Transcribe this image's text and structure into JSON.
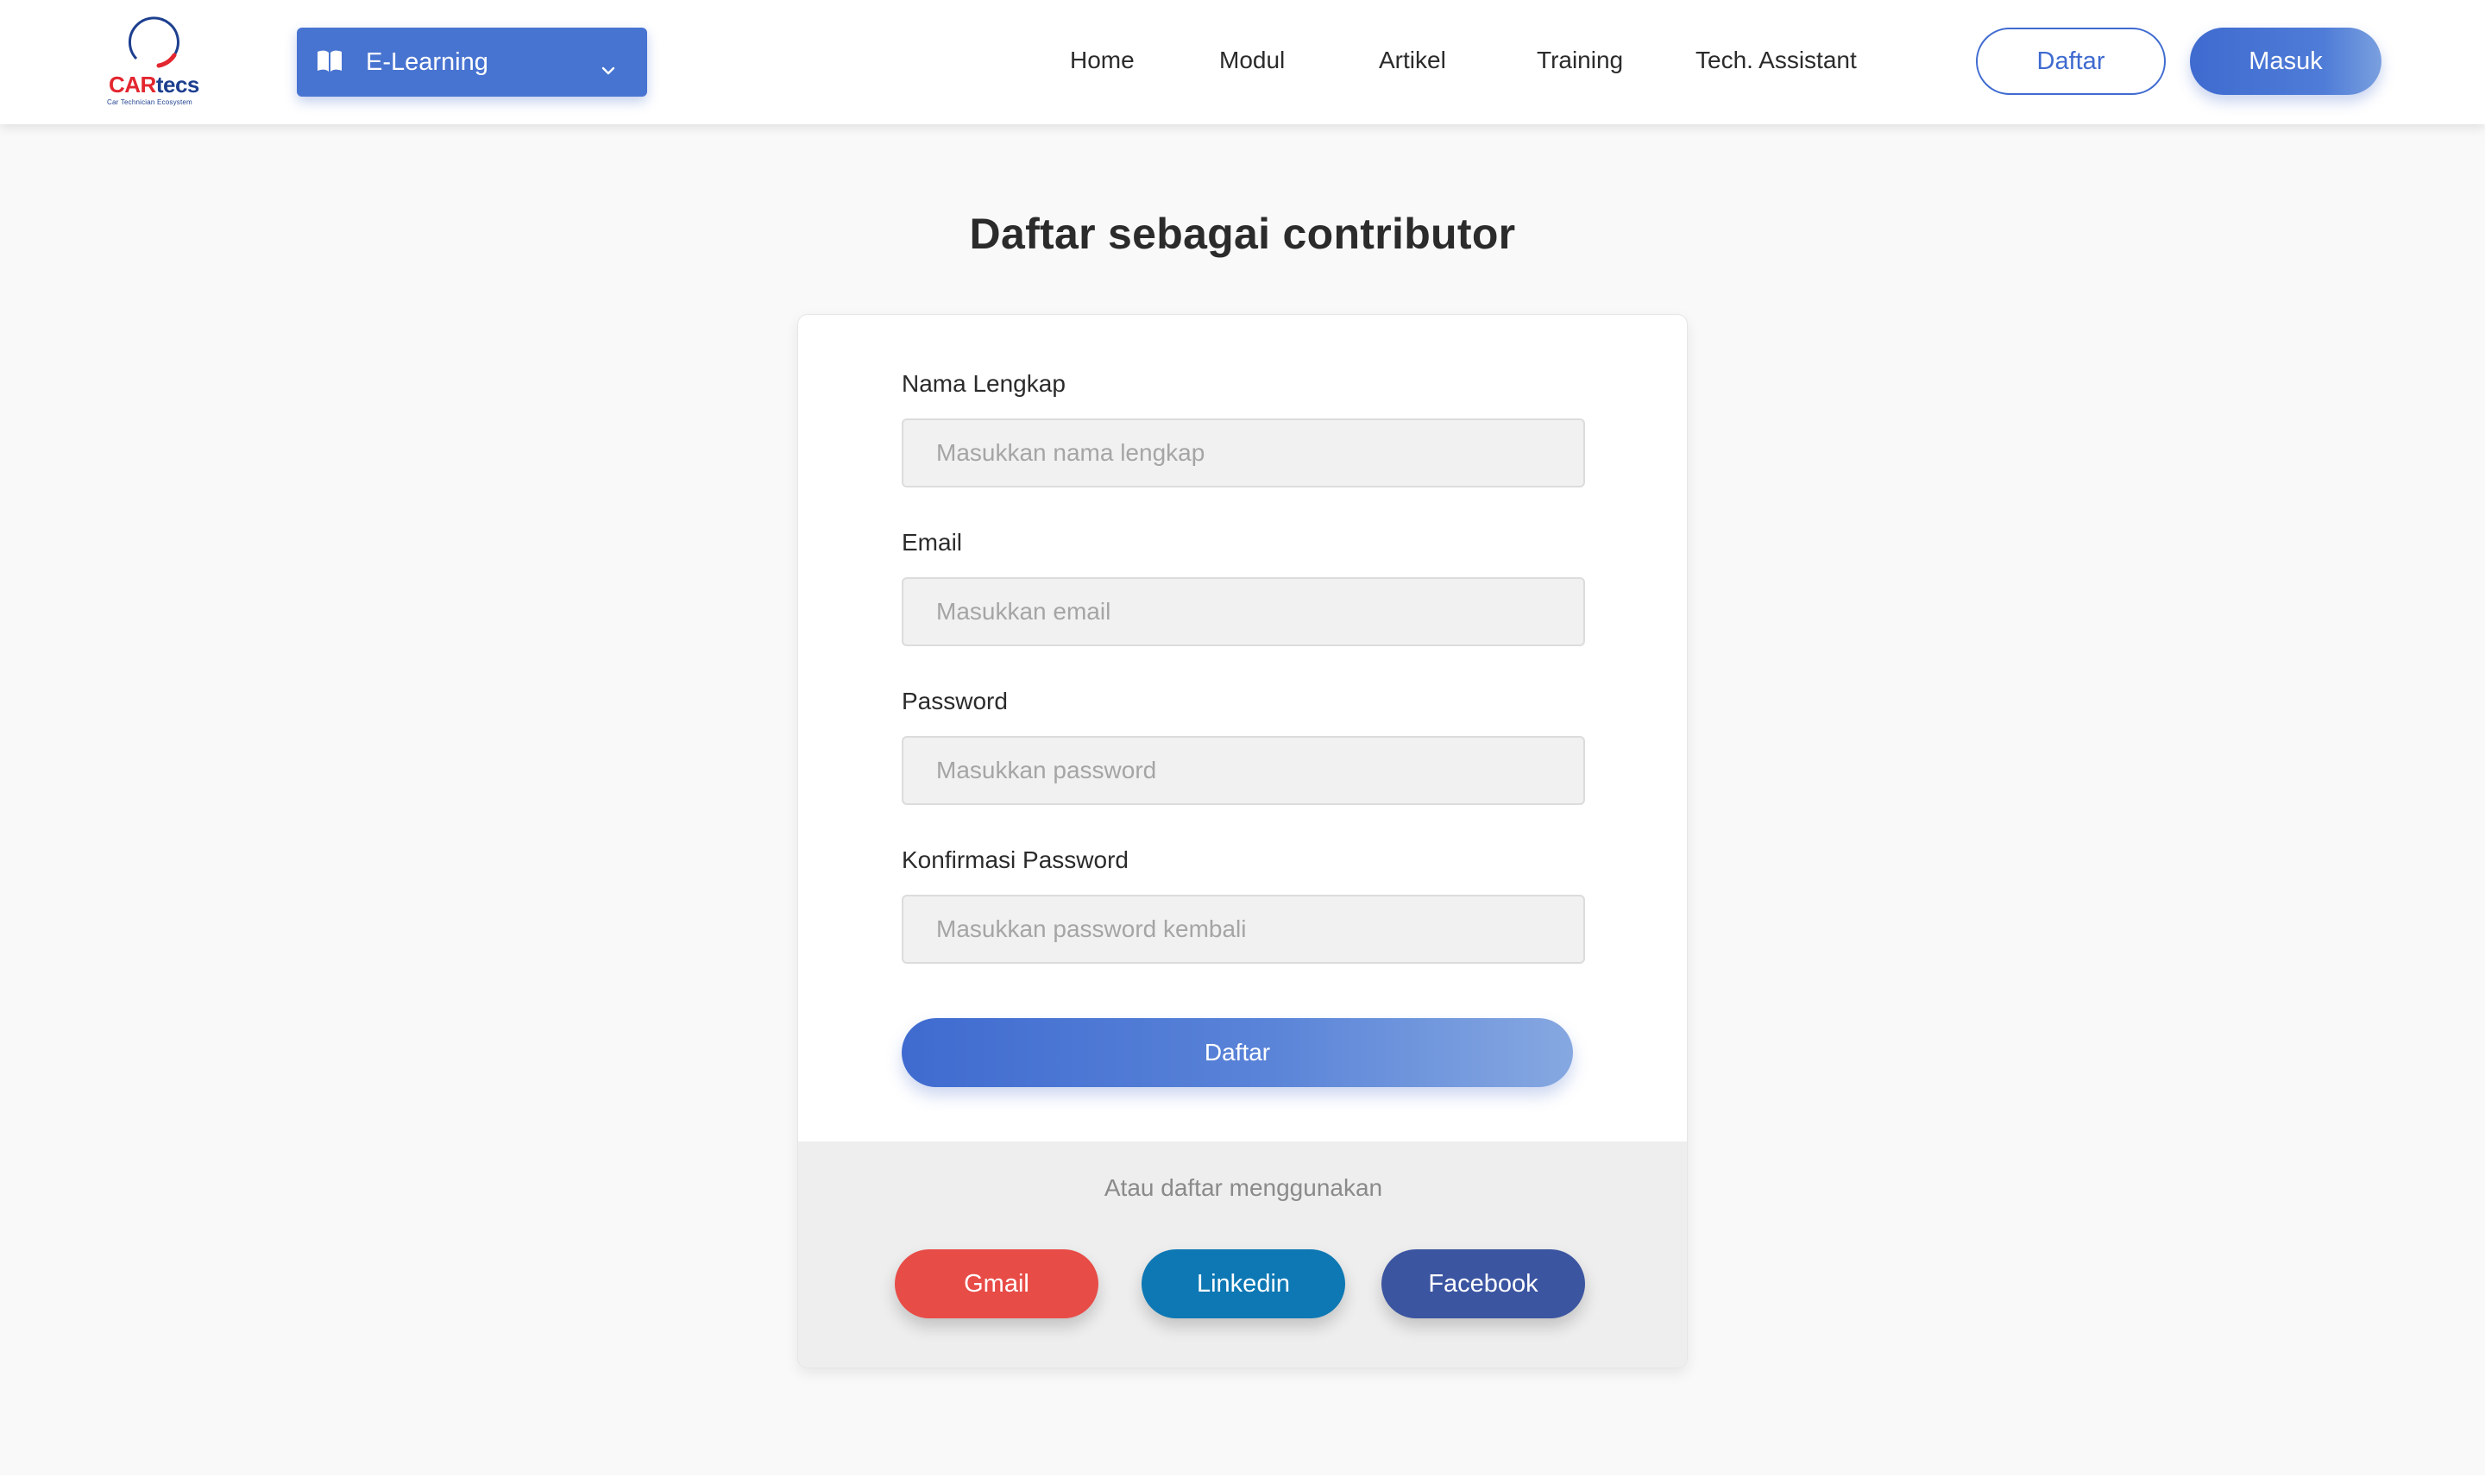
{
  "brand": {
    "name_part1": "CAR",
    "name_part2": "tecs",
    "tagline": "Car Technician Ecosystem",
    "colors": {
      "red": "#e3262f",
      "navy": "#1d3f8f"
    }
  },
  "nav": {
    "category_dropdown": {
      "label": "E-Learning",
      "icon": "book-open-icon"
    },
    "links": [
      {
        "label": "Home"
      },
      {
        "label": "Modul"
      },
      {
        "label": "Artikel"
      },
      {
        "label": "Training"
      },
      {
        "label": "Tech. Assistant"
      }
    ],
    "register_label": "Daftar",
    "login_label": "Masuk"
  },
  "page": {
    "title": "Daftar sebagai contributor"
  },
  "form": {
    "full_name": {
      "label": "Nama Lengkap",
      "placeholder": "Masukkan nama lengkap",
      "value": ""
    },
    "email": {
      "label": "Email",
      "placeholder": "Masukkan email",
      "value": ""
    },
    "password": {
      "label": "Password",
      "placeholder": "Masukkan password",
      "value": ""
    },
    "confirm_password": {
      "label": "Konfirmasi Password",
      "placeholder": "Masukkan password kembali",
      "value": ""
    },
    "submit_label": "Daftar"
  },
  "social": {
    "prompt": "Atau daftar menggunakan",
    "buttons": [
      {
        "label": "Gmail",
        "color": "#e84c47"
      },
      {
        "label": "Linkedin",
        "color": "#0d78b4"
      },
      {
        "label": "Facebook",
        "color": "#3b55a1"
      }
    ]
  },
  "colors": {
    "accent": "#3f6bd0",
    "page_background": "#f9f9f9",
    "input_background": "#f1f1f1"
  }
}
